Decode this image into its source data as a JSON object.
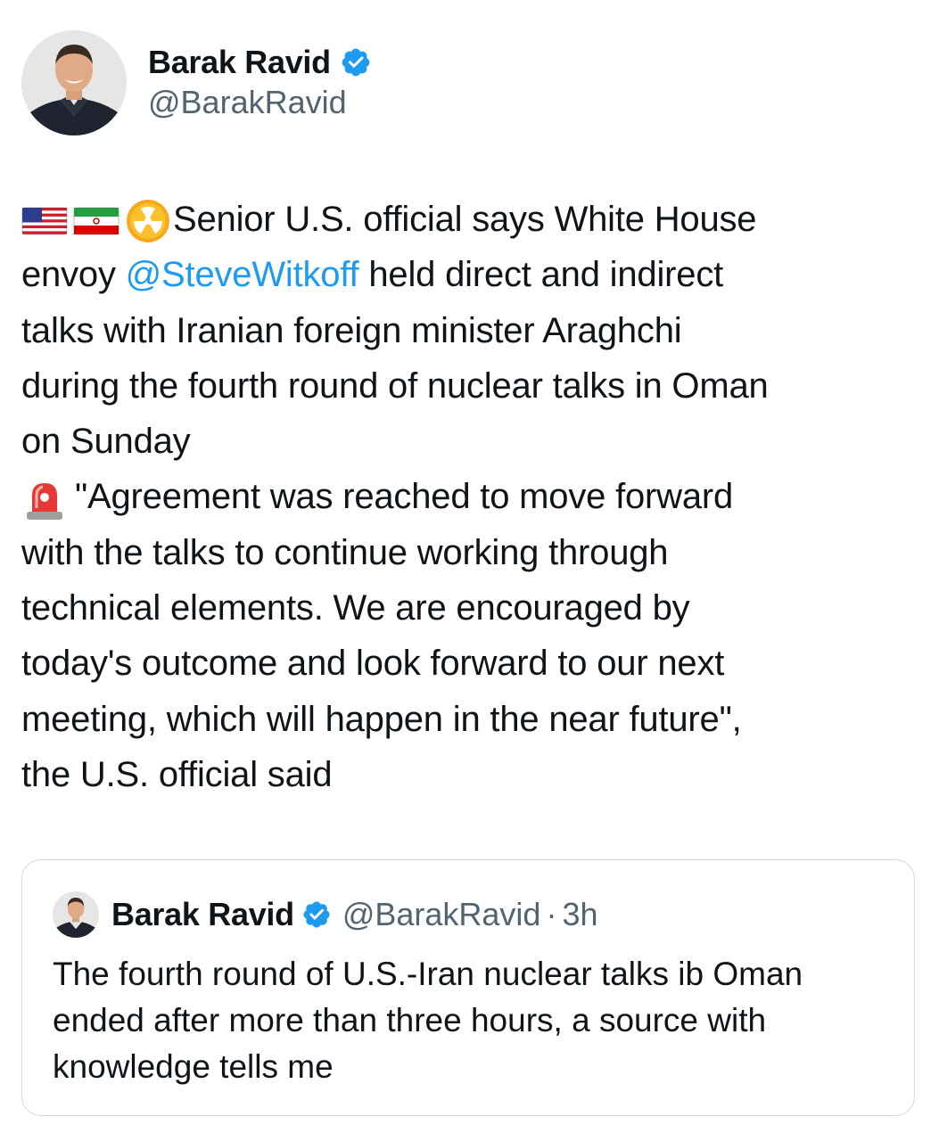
{
  "tweet": {
    "author_name": "Barak Ravid",
    "author_handle": "@BarakRavid",
    "verified_icon": "verified-badge-icon",
    "flag_icons": [
      "us-flag-icon",
      "iran-flag-icon",
      "radioactive-icon"
    ],
    "line1": "Senior U.S. official says White House",
    "line2_pre": "envoy ",
    "mention": "@SteveWitkoff",
    "line2_post": " held direct and indirect",
    "line3": "talks with Iranian foreign minister Araghchi",
    "line4": "during the fourth round of nuclear talks in Oman",
    "line5": "on Sunday",
    "alert_icon": "siren-icon",
    "line6": "\"Agreement was reached to move forward",
    "line7": "with the talks to continue working through",
    "line8": "technical elements. We are encouraged by",
    "line9": "today's outcome and look forward to our next",
    "line10": "meeting, which will happen in the near future\",",
    "line11": "the U.S. official said"
  },
  "quote": {
    "author_name": "Barak Ravid",
    "author_handle": "@BarakRavid",
    "separator": "·",
    "time": "3h",
    "line1": "The fourth round of U.S.-Iran nuclear talks ib Oman",
    "line2": "ended after more than three hours, a source with",
    "line3": "knowledge tells me"
  },
  "colors": {
    "text": "#0f1419",
    "secondary": "#536471",
    "link": "#1d9bf0",
    "border": "#cfd9de"
  }
}
